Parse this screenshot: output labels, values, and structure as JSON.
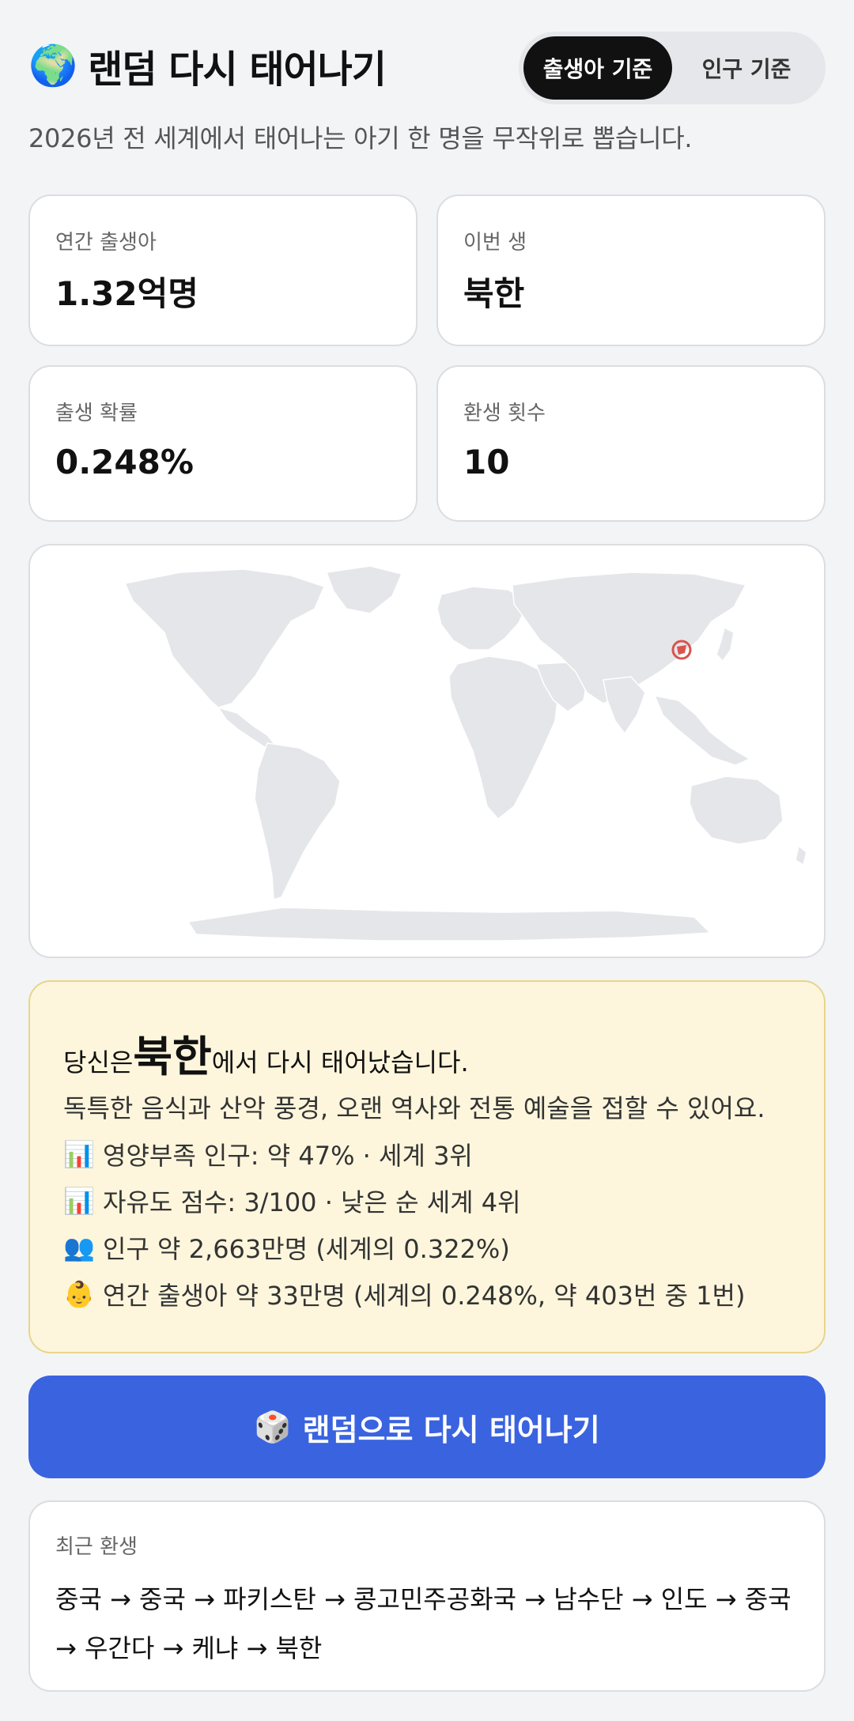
{
  "header": {
    "globe_icon": "🌍",
    "title": "랜덤 다시 태어나기",
    "tabs": [
      {
        "label": "출생아 기준",
        "active": true
      },
      {
        "label": "인구 기준",
        "active": false
      }
    ]
  },
  "subtitle": "2026년 전 세계에서 태어나는 아기 한 명을 무작위로 뽑습니다.",
  "stats": [
    {
      "label": "연간 출생아",
      "value": "1.32억명"
    },
    {
      "label": "이번 생",
      "value": "북한"
    },
    {
      "label": "출생 확률",
      "value": "0.248%"
    },
    {
      "label": "환생 횟수",
      "value": "10"
    }
  ],
  "map": {
    "highlight_color": "#d9534f",
    "land_color": "#e5e6e9"
  },
  "result": {
    "prefix": "당신은 ",
    "country": "북한",
    "suffix": "에서 다시 태어났습니다.",
    "description": "독특한 음식과 산악 풍경, 오랜 역사와 전통 예술을 접할 수 있어요.",
    "facts": [
      {
        "icon": "📊",
        "text": "영양부족 인구: 약 47% · 세계 3위"
      },
      {
        "icon": "📊",
        "text": "자유도 점수: 3/100 · 낮은 순 세계 4위"
      },
      {
        "icon": "👥",
        "text": "인구 약 2,663만명 (세계의 0.322%)"
      },
      {
        "icon": "👶",
        "text": "연간 출생아 약 33만명 (세계의 0.248%, 약 403번 중 1번)"
      }
    ]
  },
  "cta": {
    "icon": "🎲",
    "label": "랜덤으로 다시 태어나기"
  },
  "history": {
    "title": "최근 환생",
    "text": "중국 → 중국 → 파키스탄 → 콩고민주공화국 → 남수단 → 인도 → 중국 → 우간다 → 케냐 → 북한"
  },
  "colors": {
    "accent": "#3a63e0",
    "info_bg": "#fdf6dc",
    "info_border": "#e8d58a",
    "tab_active": "#111111"
  }
}
